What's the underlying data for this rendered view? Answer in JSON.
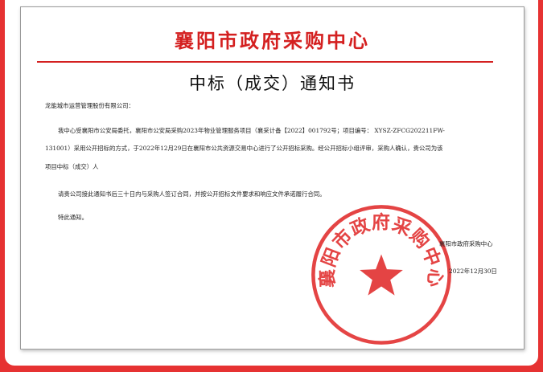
{
  "document": {
    "org_title": "襄阳市政府采购中心",
    "title": "中标（成交）通知书",
    "recipient": "龙能城市运营管理股份有限公司：",
    "body_lines": [
      "我中心受襄阳市公安局委托，襄阳市公安局采购2023年物业管理服务项目（襄采计备【2022】001792号；项目编号： XYSZ-ZFCG202211FW-",
      "131001）采用公开招标的方式，于2022年12月29日在襄阳市公共资源交易中心进行了公开招标采购。经公开招标小组评审，采购人确认，贵公司为该",
      "项目中标（成交）人"
    ],
    "instruction": "请贵公司接此通知书后三十日内与采购人签订合同，并按公开招标文件要求和响应文件承诺履行合同。",
    "closing": "特此通知。",
    "signature": "襄阳市政府采购中心",
    "date": "2022年12月30日"
  },
  "seal": {
    "text": "襄阳市政府采购中心",
    "color": "#e02424"
  },
  "colors": {
    "background": "#e63232",
    "accent": "#d42020"
  }
}
